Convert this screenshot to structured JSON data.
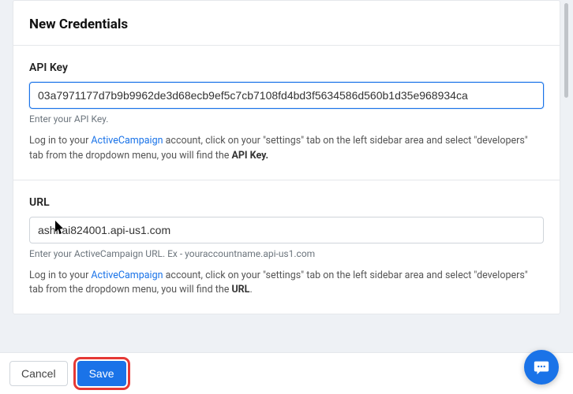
{
  "header": {
    "title": "New Credentials"
  },
  "api_key": {
    "label": "API Key",
    "value": "03a7971177d7b9b9962de3d68ecb9ef5c7cb7108fd4bd3f5634586d560b1d35e968934ca",
    "hint": "Enter your API Key.",
    "help_prefix": "Log in to your ",
    "help_link": "ActiveCampaign",
    "help_mid": " account, click on your \"settings\" tab on the left sidebar area and select \"developers\" tab from the dropdown menu, you will find the ",
    "help_bold": "API Key.",
    "help_suffix": ""
  },
  "url": {
    "label": "URL",
    "value": "ashirai824001.api-us1.com",
    "hint": "Enter your ActiveCampaign URL. Ex - youraccountname.api-us1.com",
    "help_prefix": "Log in to your ",
    "help_link": "ActiveCampaign",
    "help_mid": " account, click on your \"settings\" tab on the left sidebar area and select \"developers\" tab from the dropdown menu, you will find the ",
    "help_bold": "URL",
    "help_suffix": "."
  },
  "footer": {
    "cancel": "Cancel",
    "save": "Save"
  }
}
